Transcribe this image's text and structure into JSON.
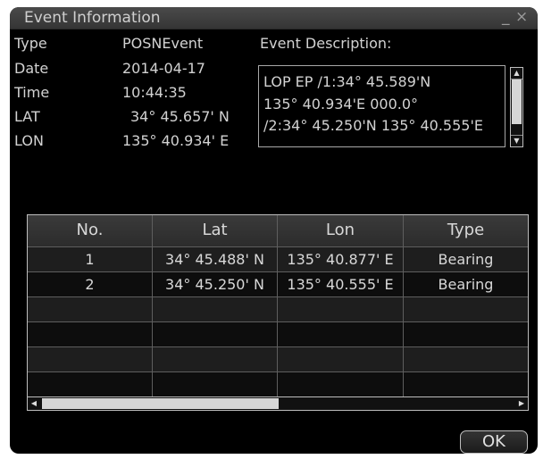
{
  "window": {
    "title": "Event Information",
    "minimize_glyph": "_",
    "close_glyph": "×"
  },
  "fields": [
    {
      "label": "Type",
      "value": "POSNEvent"
    },
    {
      "label": "Date",
      "value": "2014-04-17"
    },
    {
      "label": "Time",
      "value": "10:44:35"
    },
    {
      "label": "LAT",
      "value": "34° 45.657'  N"
    },
    {
      "label": "LON",
      "value": "135° 40.934'  E"
    }
  ],
  "description": {
    "label": "Event Description:",
    "lines": [
      "LOP EP /1:34° 45.589'N",
      "135° 40.934'E 000.0°",
      "/2:34° 45.250'N 135° 40.555'E"
    ]
  },
  "table": {
    "columns": [
      "No.",
      "Lat",
      "Lon",
      "Type"
    ],
    "rows": [
      [
        "1",
        "34° 45.488' N",
        "135° 40.877' E",
        "Bearing"
      ],
      [
        "2",
        "34° 45.250' N",
        "135° 40.555' E",
        "Bearing"
      ],
      [
        "",
        "",
        "",
        ""
      ],
      [
        "",
        "",
        "",
        ""
      ],
      [
        "",
        "",
        "",
        ""
      ],
      [
        "",
        "",
        "",
        ""
      ]
    ]
  },
  "buttons": {
    "ok": "OK"
  }
}
